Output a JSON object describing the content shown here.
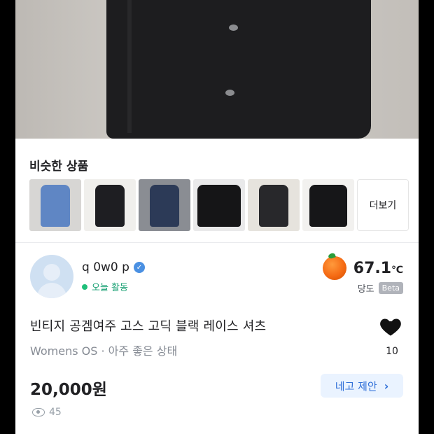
{
  "similar": {
    "title": "비슷한 상품",
    "more_label": "더보기",
    "thumbnails": [
      {
        "icon": "blue-denim-dress-thumbnail",
        "bg": "#d7d6d4",
        "color": "#5f86c4"
      },
      {
        "icon": "black-dress-thumbnail",
        "bg": "#f0efec",
        "color": "#1e1e22"
      },
      {
        "icon": "denim-jacket-thumbnail",
        "bg": "#8a8d93",
        "color": "#2c3a57"
      },
      {
        "icon": "black-shirt-thumbnail",
        "bg": "#e9e9ea",
        "color": "#151517"
      },
      {
        "icon": "black-lace-dress-thumbnail",
        "bg": "#e6e3dd",
        "color": "#28282b"
      },
      {
        "icon": "black-blouse-thumbnail",
        "bg": "#f2f1ef",
        "color": "#161618"
      }
    ]
  },
  "seller": {
    "name": "q 0w0 p",
    "activity": "오늘 활동",
    "temperature": "67.1",
    "temperature_unit": "℃",
    "manner_label": "당도",
    "beta_label": "Beta"
  },
  "item": {
    "title": "빈티지 공겜여주 고스 고딕 블랙 레이스 셔츠",
    "subtitle": "Womens OS · 아주 좋은 상태",
    "likes": "10",
    "price": "20,000원",
    "offer_label": "네고 제안",
    "views": "45"
  },
  "colors": {
    "accent": "#2f6fd8",
    "online": "#1fbf7a",
    "temperature_fruit": "#f56b14"
  }
}
